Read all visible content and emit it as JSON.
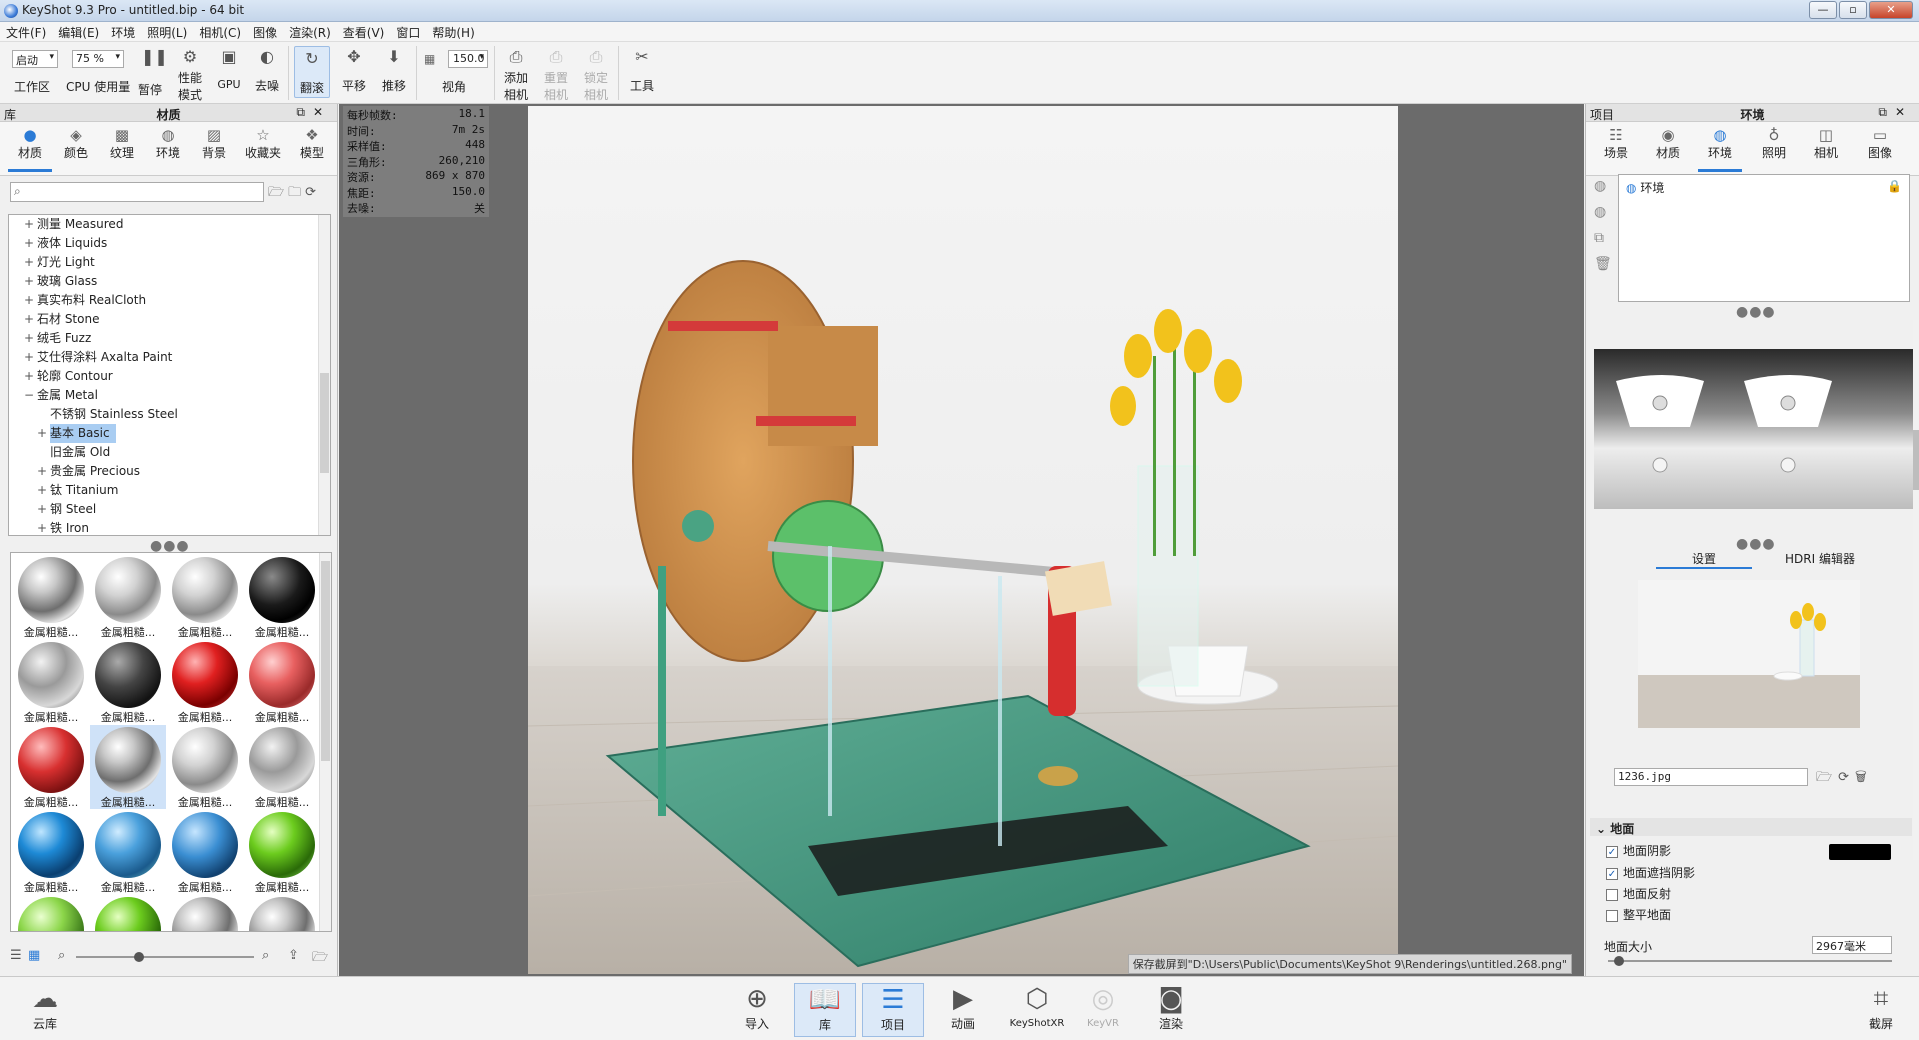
{
  "window": {
    "title": "KeyShot 9.3 Pro  - untitled.bip  - 64 bit",
    "min": "—",
    "max": "▫",
    "close": "✕"
  },
  "menu": [
    "文件(F)",
    "编辑(E)",
    "环境",
    "照明(L)",
    "相机(C)",
    "图像",
    "渲染(R)",
    "查看(V)",
    "窗口",
    "帮助(H)"
  ],
  "toolbar": {
    "workspace_select": "启动",
    "workspace_label": "工作区",
    "cpu_select": "75 %",
    "cpu_label": "CPU 使用量",
    "pause": "暂停",
    "perf_label_1": "性能",
    "perf_label_2": "模式",
    "gpu": "GPU",
    "denoise": "去噪",
    "tumble": "翻滚",
    "pan": "平移",
    "dolly": "推移",
    "fov_value": "150.0",
    "fov_label": "视角",
    "add_camera_1": "添加",
    "add_camera_2": "相机",
    "reset_camera_1": "重置",
    "reset_camera_2": "相机",
    "lock_camera_1": "锁定",
    "lock_camera_2": "相机",
    "tools": "工具"
  },
  "library": {
    "header_left": "库",
    "header_title": "材质",
    "tabs": [
      "材质",
      "颜色",
      "纹理",
      "环境",
      "背景",
      "收藏夹",
      "模型"
    ],
    "search_placeholder": "",
    "tree": [
      {
        "ex": "+",
        "label": "测量 Measured",
        "level": 0
      },
      {
        "ex": "+",
        "label": "液体 Liquids",
        "level": 0
      },
      {
        "ex": "+",
        "label": "灯光 Light",
        "level": 0
      },
      {
        "ex": "+",
        "label": "玻璃 Glass",
        "level": 0
      },
      {
        "ex": "+",
        "label": "真实布料 RealCloth",
        "level": 0
      },
      {
        "ex": "+",
        "label": "石材 Stone",
        "level": 0
      },
      {
        "ex": "+",
        "label": "绒毛 Fuzz",
        "level": 0
      },
      {
        "ex": "+",
        "label": "艾仕得涂料 Axalta Paint",
        "level": 0
      },
      {
        "ex": "+",
        "label": "轮廓 Contour",
        "level": 0
      },
      {
        "ex": "−",
        "label": "金属 Metal",
        "level": 0
      },
      {
        "ex": "",
        "label": "不锈钢 Stainless Steel",
        "level": 1
      },
      {
        "ex": "+",
        "label": "基本 Basic",
        "level": 1,
        "selected": true
      },
      {
        "ex": "",
        "label": "旧金属 Old",
        "level": 1
      },
      {
        "ex": "+",
        "label": "贵金属 Precious",
        "level": 1
      },
      {
        "ex": "+",
        "label": "钛 Titanium",
        "level": 1
      },
      {
        "ex": "+",
        "label": "钢 Steel",
        "level": 1
      },
      {
        "ex": "+",
        "label": "铁 Iron",
        "level": 1
      }
    ],
    "material_label": "金属粗糙...",
    "materials": [
      {
        "style": "chrome"
      },
      {
        "style": "chrome-dots"
      },
      {
        "style": "chrome-dots"
      },
      {
        "style": "black"
      },
      {
        "style": "chrome-holes"
      },
      {
        "style": "dark-holes"
      },
      {
        "style": "red"
      },
      {
        "style": "red-dots"
      },
      {
        "style": "red-holes"
      },
      {
        "style": "chrome",
        "selected": true
      },
      {
        "style": "chrome-dots"
      },
      {
        "style": "chrome-holes"
      },
      {
        "style": "blue"
      },
      {
        "style": "blue-dots"
      },
      {
        "style": "blue-holes"
      },
      {
        "style": "green"
      },
      {
        "style": "green-dots"
      },
      {
        "style": "green"
      },
      {
        "style": "chrome"
      },
      {
        "style": "chrome"
      }
    ]
  },
  "viewport": {
    "stats": [
      {
        "k": "每秒帧数:",
        "v": "18.1"
      },
      {
        "k": "时间:",
        "v": "7m 2s"
      },
      {
        "k": "采样值:",
        "v": "448"
      },
      {
        "k": "三角形:",
        "v": "260,210"
      },
      {
        "k": "资源:",
        "v": "869 x 870"
      },
      {
        "k": "焦距:",
        "v": "150.0"
      },
      {
        "k": "去噪:",
        "v": "关"
      }
    ],
    "status": "保存截屏到\"D:\\Users\\Public\\Documents\\KeyShot 9\\Renderings\\untitled.268.png\""
  },
  "project": {
    "header_left": "项目",
    "header_title": "环境",
    "tabs": [
      "场景",
      "材质",
      "环境",
      "照明",
      "相机",
      "图像"
    ],
    "env_item": "环境",
    "subtabs": [
      "设置",
      "HDRI 编辑器"
    ],
    "hdri_file": "1236.jpg",
    "ground_section": "地面",
    "ground_shadow": "地面阴影",
    "ground_occlusion": "地面遮挡阴影",
    "ground_reflection": "地面反射",
    "flatten_ground": "整平地面",
    "ground_size_label": "地面大小",
    "ground_size_value": "2967毫米",
    "shadow_color": "#000000"
  },
  "bottom": {
    "cloud": "云库",
    "import": "导入",
    "library": "库",
    "project": "项目",
    "animation": "动画",
    "keyshotxr": "KeyShotXR",
    "keyvr": "KeyVR",
    "render": "渲染",
    "screenshot": "截屏"
  }
}
